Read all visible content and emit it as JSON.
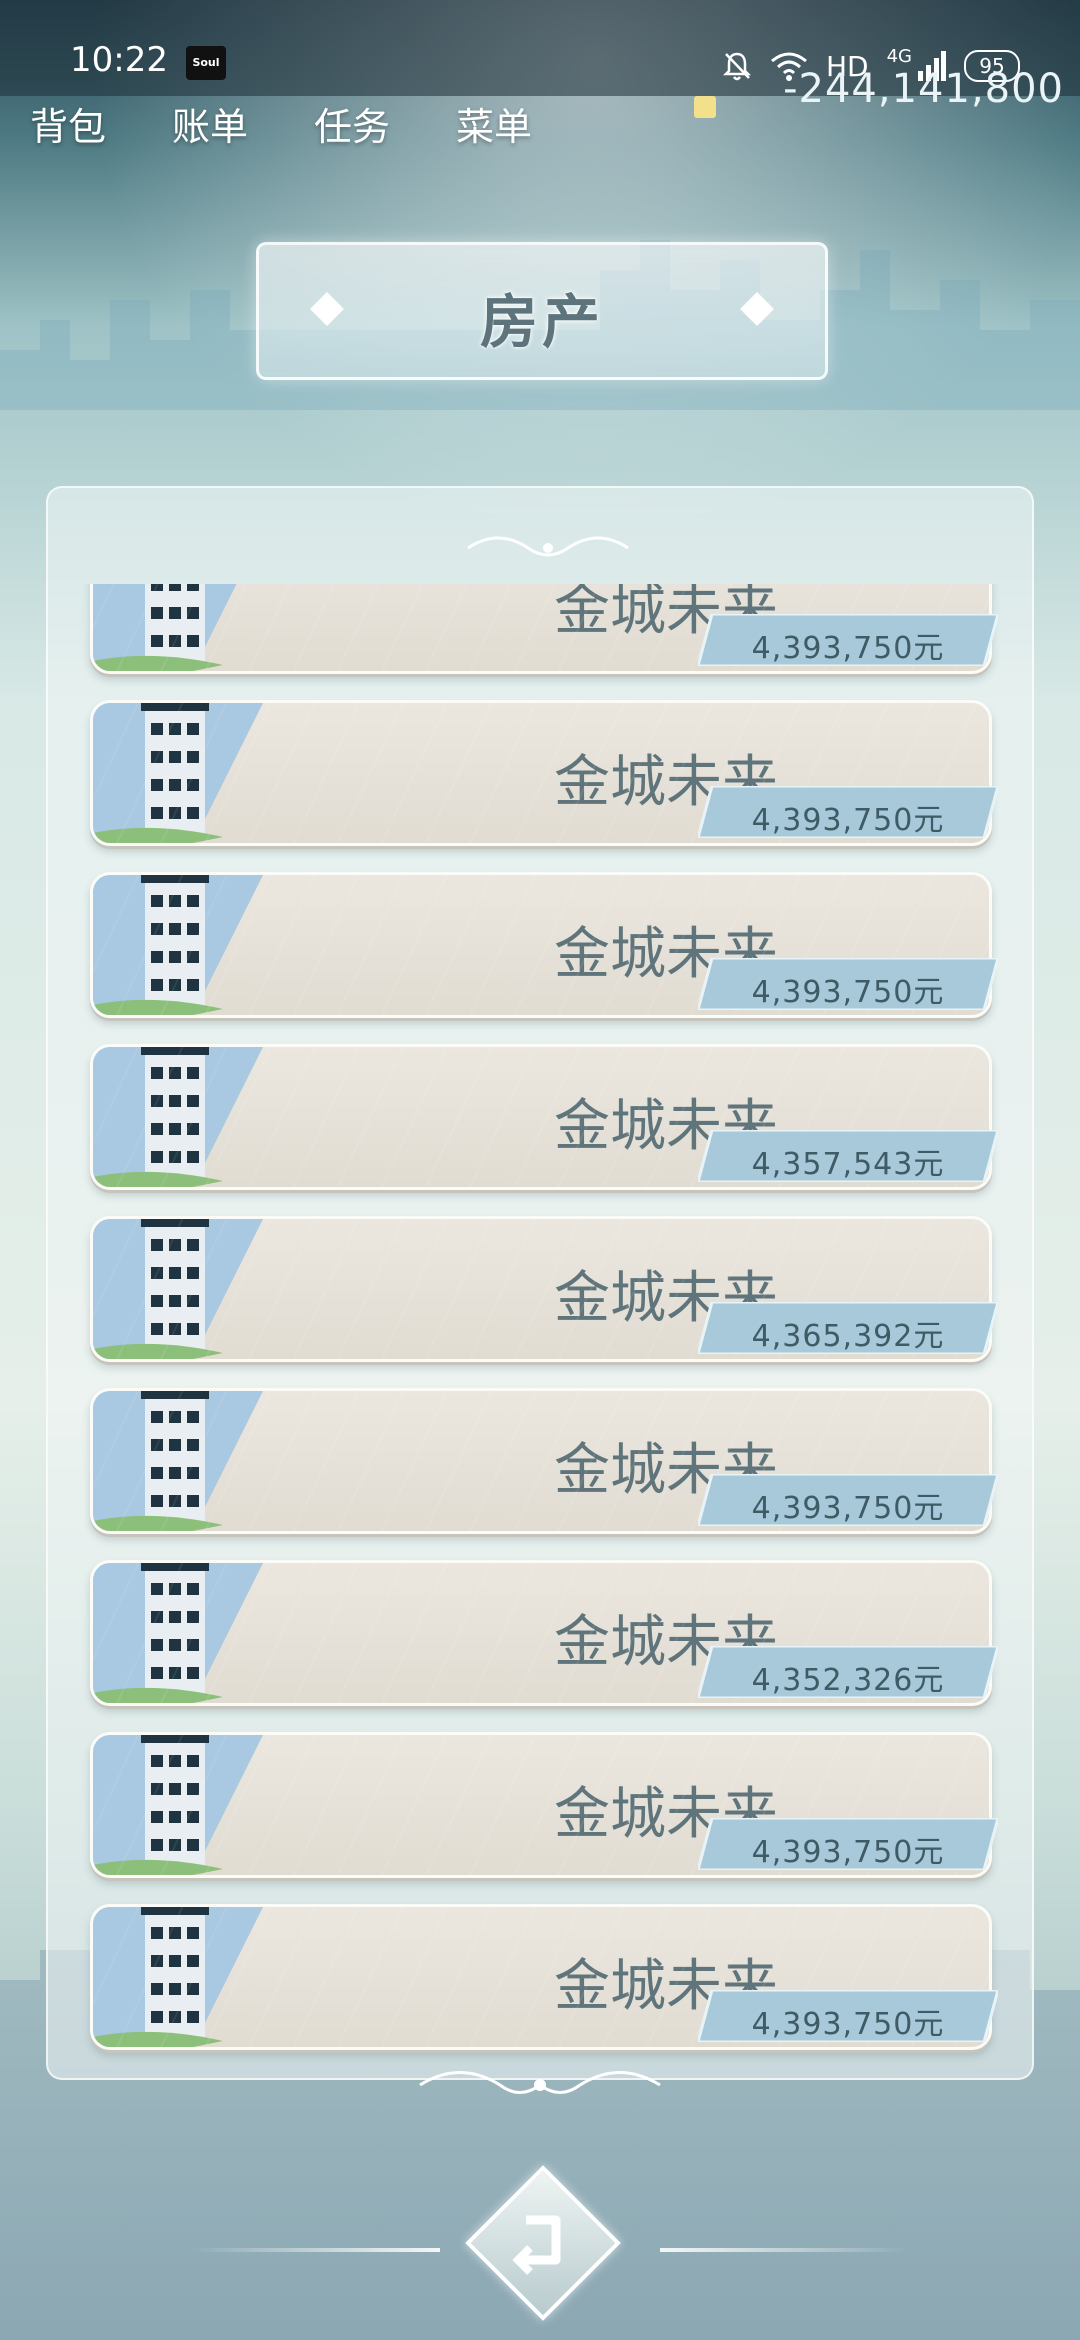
{
  "status_bar": {
    "time": "10:22",
    "app_badge": "Soul",
    "network": "HD",
    "signal_type": "4G",
    "battery": "95"
  },
  "nav": [
    "背包",
    "账单",
    "任务",
    "菜单"
  ],
  "money": "-244,141,800",
  "title": "房产",
  "properties": [
    {
      "name": "金城未来",
      "price": "4,393,750元"
    },
    {
      "name": "金城未来",
      "price": "4,393,750元"
    },
    {
      "name": "金城未来",
      "price": "4,393,750元"
    },
    {
      "name": "金城未来",
      "price": "4,357,543元"
    },
    {
      "name": "金城未来",
      "price": "4,365,392元"
    },
    {
      "name": "金城未来",
      "price": "4,393,750元"
    },
    {
      "name": "金城未来",
      "price": "4,352,326元"
    },
    {
      "name": "金城未来",
      "price": "4,393,750元"
    },
    {
      "name": "金城未来",
      "price": "4,393,750元"
    }
  ],
  "icons": {
    "back": "back-arrow-icon",
    "building": "building-icon",
    "bell": "bell-muted-icon",
    "wifi": "wifi-icon"
  }
}
